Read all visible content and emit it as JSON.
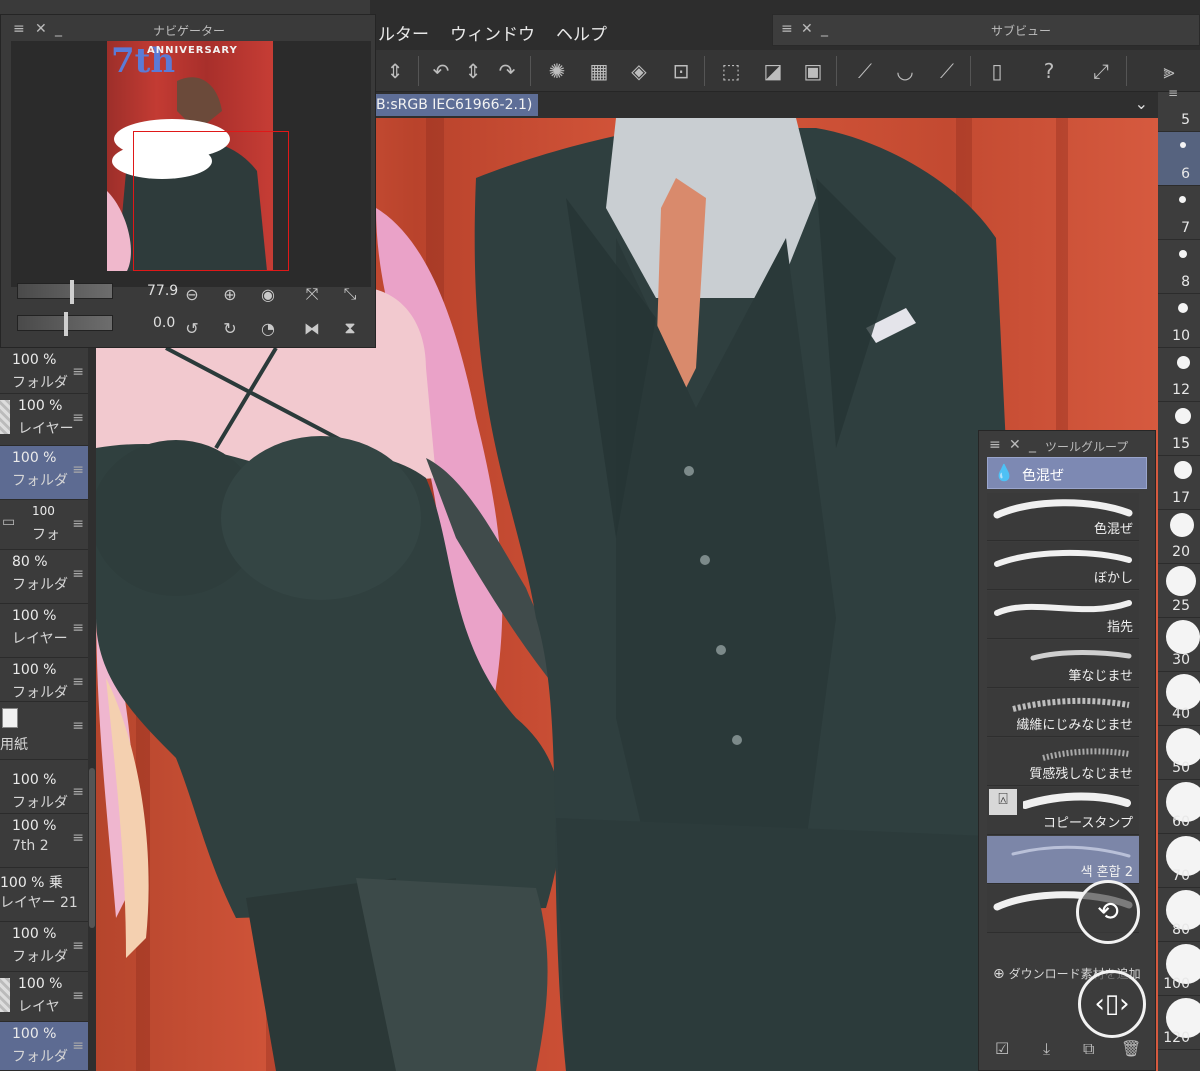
{
  "menubar": {
    "items": [
      "ルター",
      "ウィンドウ",
      "ヘルプ"
    ]
  },
  "docbar": {
    "color_profile": "B:sRGB IEC61966-2.1)"
  },
  "subview": {
    "title": "サブビュー"
  },
  "navigator": {
    "title": "ナビゲーター",
    "zoom": "77.9",
    "rotation": "0.0",
    "thumb_text_big": "7th",
    "thumb_text_small": "ANNIVERSARY"
  },
  "layers": [
    {
      "pct": "100 %",
      "name": "フォルダ",
      "selected": false
    },
    {
      "pct": "100 %",
      "name": "レイヤー",
      "selected": false
    },
    {
      "pct": "100 %",
      "name": "フォルダ",
      "selected": true
    },
    {
      "pct": "100",
      "name": "フォ",
      "selected": false
    },
    {
      "pct": "80 %",
      "name": "フォルダ",
      "selected": false
    },
    {
      "pct": "100 %",
      "name": "レイヤー",
      "selected": false
    },
    {
      "pct": "100 %",
      "name": "フォルダ",
      "selected": false
    },
    {
      "pct": "",
      "name": "用紙",
      "selected": false
    },
    {
      "pct": "100 %",
      "name": "フォルダ",
      "selected": false
    },
    {
      "pct": "100 %",
      "name": "7th 2",
      "selected": false
    },
    {
      "pct": "100 % 乗",
      "name": "レイヤー 21",
      "selected": false
    },
    {
      "pct": "100 %",
      "name": "フォルダ",
      "selected": false
    },
    {
      "pct": "100 %",
      "name": "レイヤ",
      "selected": false
    },
    {
      "pct": "100 %",
      "name": "フォルダ",
      "selected": true
    }
  ],
  "toolgroup": {
    "title": "ツールグループ",
    "group_name": "色混ぜ",
    "brushes": [
      {
        "label": "色混ぜ",
        "selected": false
      },
      {
        "label": "ぼかし",
        "selected": false
      },
      {
        "label": "指先",
        "selected": false
      },
      {
        "label": "筆なじませ",
        "selected": false
      },
      {
        "label": "繊維にじみなじませ",
        "selected": false
      },
      {
        "label": "質感残しなじませ",
        "selected": false
      },
      {
        "label": "コピースタンプ",
        "selected": false
      },
      {
        "label": "색 혼합 2",
        "selected": true
      },
      {
        "label": "",
        "selected": false
      }
    ],
    "download_label": "ダウンロード素材を追加"
  },
  "sizes": [
    "5",
    "6",
    "7",
    "8",
    "10",
    "12",
    "15",
    "17",
    "20",
    "25",
    "30",
    "40",
    "50",
    "60",
    "70",
    "80",
    "100",
    "120"
  ],
  "colors": {
    "accent": "#5d6b92",
    "selection": "#7d89b3",
    "background_red": "#c84d34"
  }
}
